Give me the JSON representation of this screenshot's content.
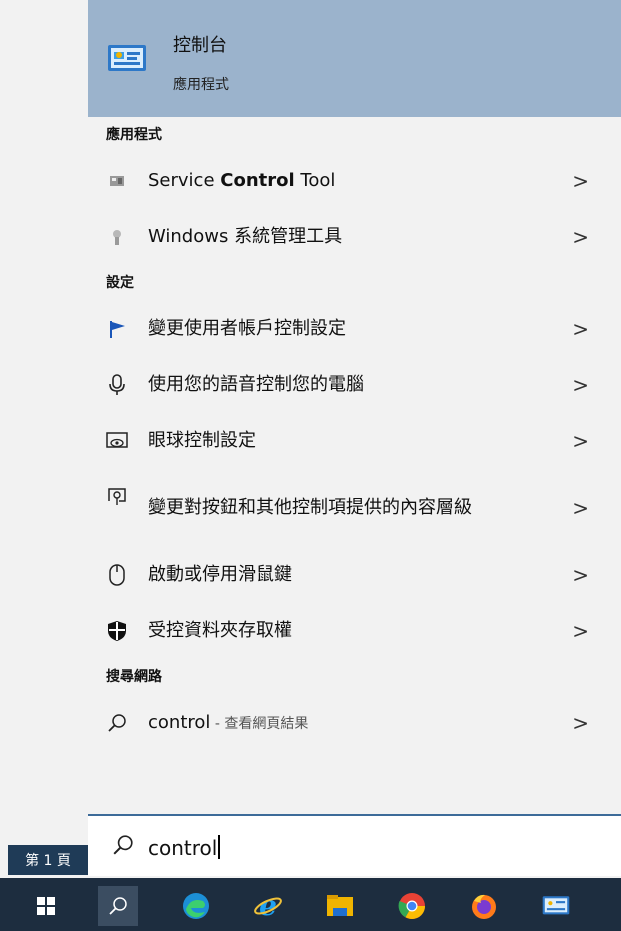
{
  "best_match": {
    "title": "控制台",
    "subtitle": "應用程式",
    "icon": "control-panel-icon"
  },
  "sections": {
    "apps": "應用程式",
    "settings": "設定",
    "web": "搜尋網路"
  },
  "apps": [
    {
      "pre": "Service ",
      "bold": "Control",
      "post": " Tool",
      "icon": "service-control-tool-icon"
    },
    {
      "label": "Windows 系統管理工具",
      "icon": "windows-admin-tools-icon"
    }
  ],
  "settings": [
    {
      "label": "變更使用者帳戶控制設定",
      "icon": "flag-icon"
    },
    {
      "label": "使用您的語音控制您的電腦",
      "icon": "microphone-icon"
    },
    {
      "label": "眼球控制設定",
      "icon": "eye-control-icon"
    },
    {
      "label": "變更對按鈕和其他控制項提供的內容層級",
      "icon": "touch-icon"
    },
    {
      "label": "啟動或停用滑鼠鍵",
      "icon": "mouse-icon"
    },
    {
      "label": "受控資料夾存取權",
      "icon": "shield-icon"
    }
  ],
  "web": {
    "query": "control",
    "suffix": " - 查看網頁結果"
  },
  "search": {
    "value": "control"
  },
  "page_badge": "第 1 頁",
  "chevron": ">",
  "taskbar": [
    "windows-start-icon",
    "search-icon",
    "edge-icon",
    "internet-explorer-icon",
    "file-explorer-icon",
    "chrome-icon",
    "firefox-icon",
    "control-panel-icon"
  ]
}
